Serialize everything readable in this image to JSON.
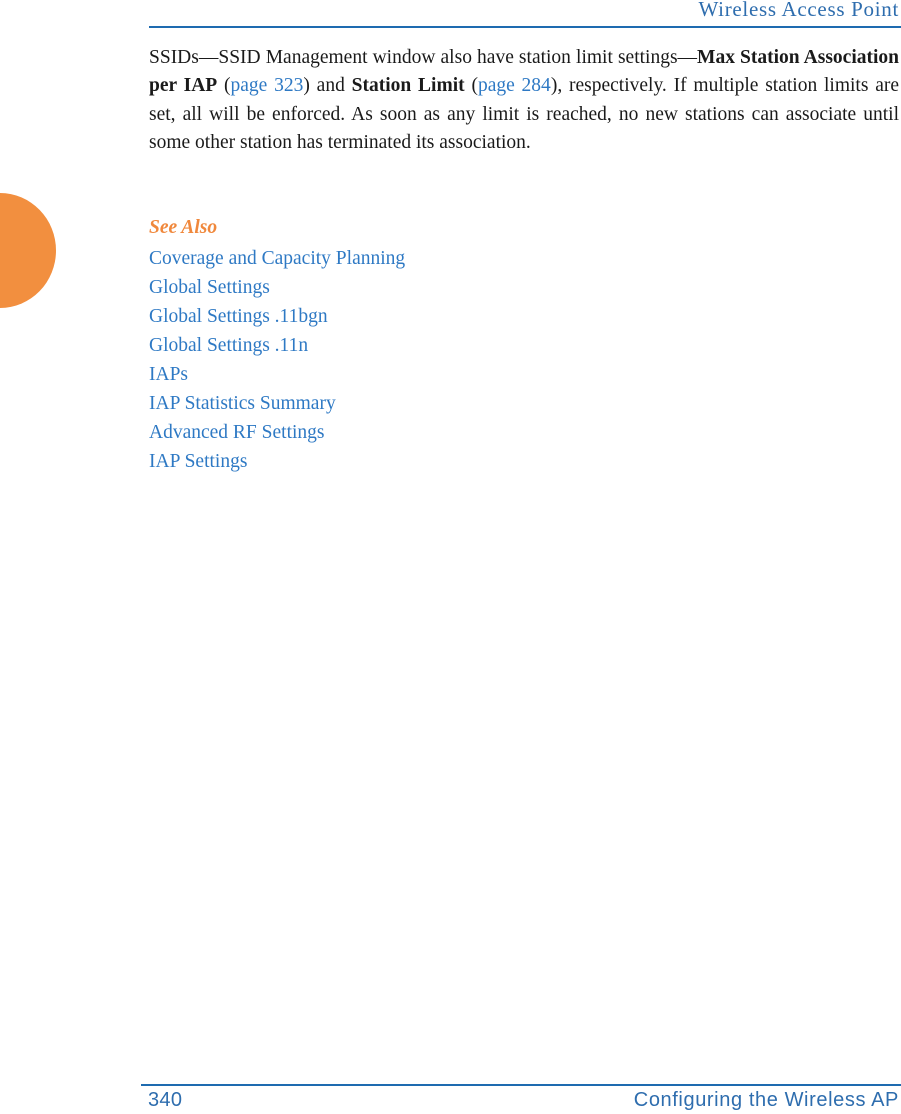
{
  "header": {
    "title": "Wireless Access Point"
  },
  "body": {
    "paragraph": {
      "segment_1": "SSIDs—SSID Management window also have station limit settings—",
      "bold_1": "Max Station Association per IAP",
      "paren_open_1": "(",
      "link_1": "page 323",
      "paren_close_1": ")",
      "segment_2": " and ",
      "bold_2": "Station Limit",
      "paren_open_2": "(",
      "link_2": "page 284",
      "paren_close_2": ")",
      "segment_3": ", respectively. If multiple station limits are set, all will be enforced. As soon as any limit is reached, no new stations can associate until some other station has terminated its association."
    }
  },
  "see_also": {
    "heading": "See Also",
    "links": [
      "Coverage and Capacity Planning",
      "Global Settings",
      "Global Settings .11bgn",
      "Global Settings .11n",
      "IAPs",
      "IAP Statistics Summary",
      "Advanced RF Settings",
      "IAP Settings"
    ]
  },
  "footer": {
    "page_number": "340",
    "section_title": "Configuring the Wireless AP"
  },
  "colors": {
    "link_blue": "#2E79C4",
    "rule_blue": "#1E6BB0",
    "header_blue": "#2E6DAE",
    "accent_orange": "#F0883C",
    "tab_orange": "#F28F3F",
    "body_text": "#1a1a1a"
  }
}
